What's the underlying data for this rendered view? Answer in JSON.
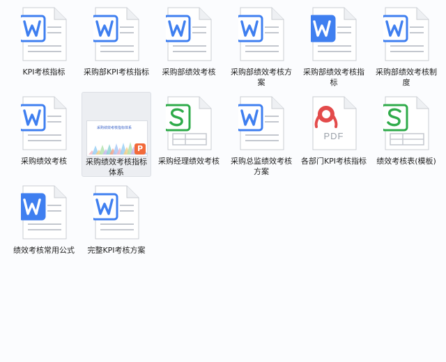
{
  "colors": {
    "word": "#3f7ff0",
    "sheet": "#2fab4a",
    "pdf": "#e34b4b",
    "ppt": "#f26a3a"
  },
  "pdf_text": "PDF",
  "ppt_badge": "P",
  "thumb_title": "采购绩效考核指标体系",
  "files": [
    {
      "name": "KPI考核指标",
      "type": "word-outline"
    },
    {
      "name": "采购部KPI考核指标",
      "type": "word-outline"
    },
    {
      "name": "采购部绩效考核",
      "type": "word-outline"
    },
    {
      "name": "采购部绩效考核方案",
      "type": "word-outline"
    },
    {
      "name": "采购部绩效考核指标",
      "type": "word-solid"
    },
    {
      "name": "采购部绩效考核制度",
      "type": "word-outline"
    },
    {
      "name": "采购绩效考核",
      "type": "word-outline"
    },
    {
      "name": "采购绩效考核指标体系",
      "type": "ppt-thumb",
      "selected": true
    },
    {
      "name": "采购经理绩效考核",
      "type": "sheet"
    },
    {
      "name": "采购总监绩效考核方案",
      "type": "word-outline"
    },
    {
      "name": "各部门KPI考核指标",
      "type": "pdf"
    },
    {
      "name": "绩效考核表(模板)",
      "type": "sheet"
    },
    {
      "name": "绩效考核常用公式",
      "type": "word-solid"
    },
    {
      "name": "完整KPI考核方案",
      "type": "word-outline"
    }
  ]
}
